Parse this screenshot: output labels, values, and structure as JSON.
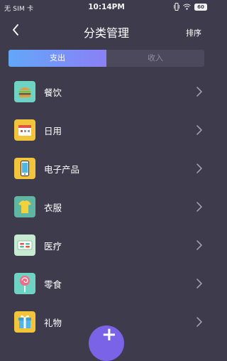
{
  "status_bar": {
    "carrier": "无 SIM 卡",
    "time": "10:14PM",
    "battery": "60",
    "icons": [
      "vibrate-icon",
      "wifi-icon",
      "battery-icon"
    ]
  },
  "header": {
    "title": "分类管理",
    "back_icon": "chevron-left-icon",
    "sort_label": "排序"
  },
  "tabs": [
    {
      "label": "支出",
      "active": true
    },
    {
      "label": "收入",
      "active": false
    }
  ],
  "categories": [
    {
      "label": "餐饮",
      "icon": "burger-icon",
      "color": "#6fd3c3"
    },
    {
      "label": "日用",
      "icon": "calendar-icon",
      "color": "#f2c43c"
    },
    {
      "label": "电子产品",
      "icon": "phone-icon",
      "color": "#f2c43c"
    },
    {
      "label": "衣服",
      "icon": "tshirt-icon",
      "color": "#5fb7a3"
    },
    {
      "label": "医疗",
      "icon": "medicine-icon",
      "color": "#c6ead2"
    },
    {
      "label": "零食",
      "icon": "lollipop-icon",
      "color": "#6fd3c3"
    },
    {
      "label": "礼物",
      "icon": "gift-icon",
      "color": "#f2c43c"
    }
  ],
  "fab": {
    "icon": "plus-icon",
    "label": "+"
  },
  "colors": {
    "background": "#3e3c4c",
    "accent_start": "#63a7f8",
    "accent_end": "#8b80f6",
    "fab": "#7a63e6"
  }
}
